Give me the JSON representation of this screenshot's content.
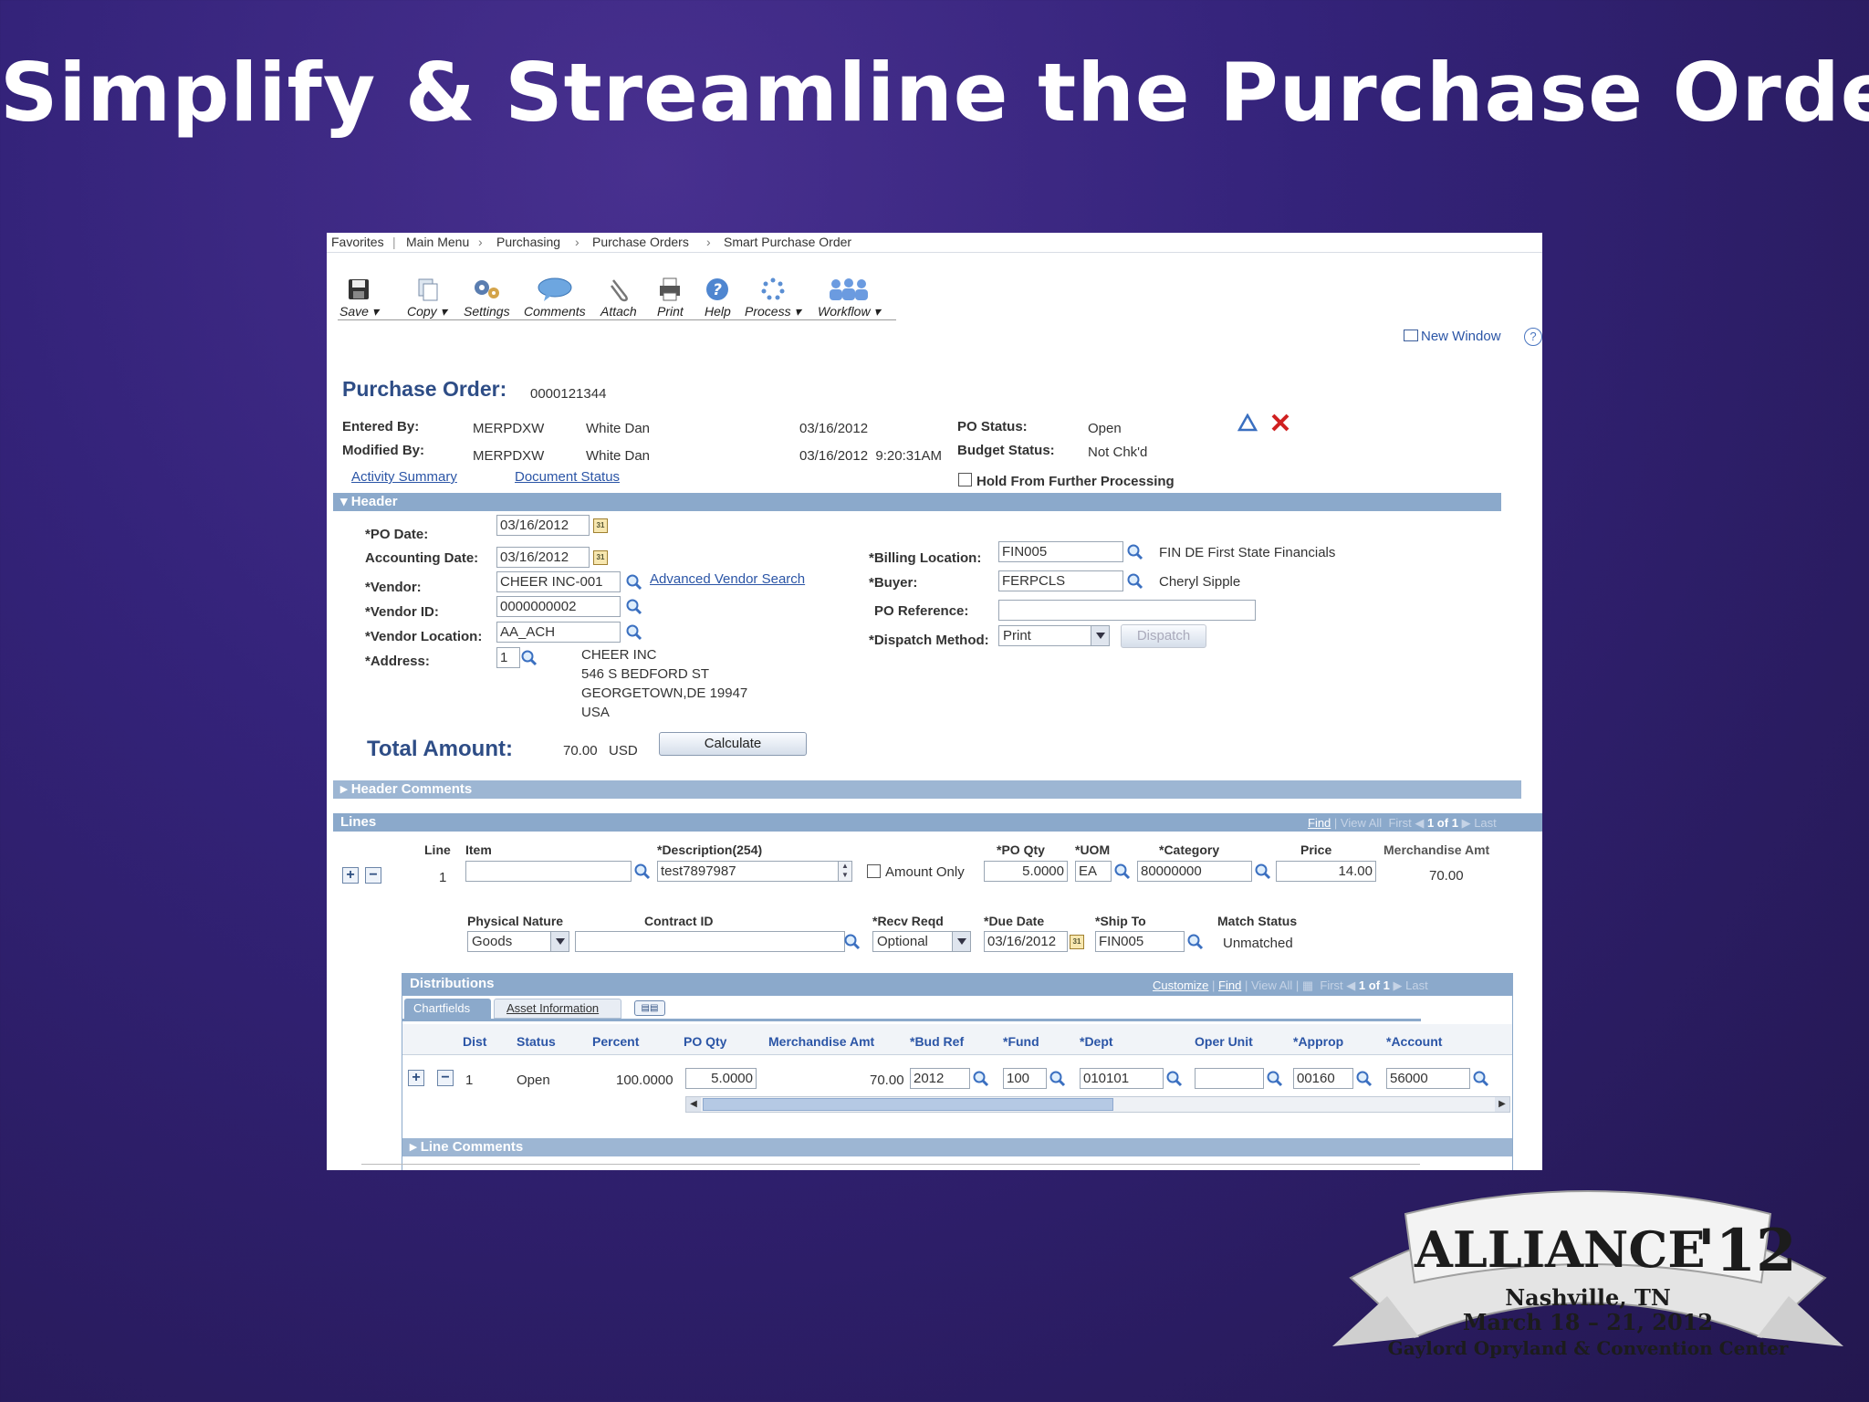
{
  "slide": {
    "title": "Simplify & Streamline the Purchase Order"
  },
  "breadcrumb": [
    "Favorites",
    "Main Menu",
    "Purchasing",
    "Purchase Orders",
    "Smart Purchase Order"
  ],
  "toolbar": [
    "Save",
    "Copy",
    "Settings",
    "Comments",
    "Attach",
    "Print",
    "Help",
    "Process",
    "Workflow"
  ],
  "new_window": "New Window",
  "po": {
    "title": "Purchase Order:",
    "number": "0000121344",
    "entered_by_label": "Entered By:",
    "entered_by_id": "MERPDXW",
    "entered_by_name": "White Dan",
    "entered_date": "03/16/2012",
    "modified_by_label": "Modified By:",
    "modified_by_id": "MERPDXW",
    "modified_by_name": "White Dan",
    "modified_date": "03/16/2012  9:20:31AM",
    "po_status_label": "PO Status:",
    "po_status": "Open",
    "budget_status_label": "Budget Status:",
    "budget_status": "Not Chk'd",
    "activity_summary": "Activity Summary",
    "document_status": "Document Status",
    "hold": "Hold From Further Processing"
  },
  "header": {
    "section": "Header",
    "po_date_label": "*PO Date:",
    "po_date": "03/16/2012",
    "accounting_date_label": "Accounting Date:",
    "accounting_date": "03/16/2012",
    "vendor_label": "*Vendor:",
    "vendor": "CHEER INC-001",
    "advanced_vendor_search": "Advanced Vendor Search",
    "vendor_id_label": "*Vendor ID:",
    "vendor_id": "0000000002",
    "vendor_location_label": "*Vendor Location:",
    "vendor_location": "AA_ACH",
    "address_label": "*Address:",
    "address_seq": "1",
    "address_lines": [
      "CHEER INC",
      "546 S BEDFORD ST",
      "GEORGETOWN,DE 19947",
      "USA"
    ],
    "billing_location_label": "*Billing Location:",
    "billing_location": "FIN005",
    "billing_location_desc": "FIN DE First State Financials",
    "buyer_label": "*Buyer:",
    "buyer": "FERPCLS",
    "buyer_name": "Cheryl Sipple",
    "po_reference_label": "PO Reference:",
    "po_reference": "",
    "dispatch_method_label": "*Dispatch Method:",
    "dispatch_method": "Print",
    "dispatch_button": "Dispatch",
    "total_label": "Total Amount:",
    "total_amount": "70.00",
    "currency": "USD",
    "calculate": "Calculate",
    "header_comments": "Header Comments"
  },
  "lines": {
    "section": "Lines",
    "nav": {
      "find": "Find",
      "view_all": "View All",
      "first": "First",
      "count": "1 of 1",
      "last": "Last"
    },
    "headers": {
      "line": "Line",
      "item": "Item",
      "description": "*Description(254)",
      "po_qty": "*PO Qty",
      "uom": "*UOM",
      "category": "*Category",
      "price": "Price",
      "merch_amt": "Merchandise Amt"
    },
    "row": {
      "line": "1",
      "item": "",
      "description": "test7897987",
      "amount_only": "Amount Only",
      "po_qty": "5.0000",
      "uom": "EA",
      "category": "80000000",
      "price": "14.00",
      "merch_amt": "70.00"
    },
    "headers2": {
      "physical_nature": "Physical Nature",
      "contract_id": "Contract ID",
      "recv_reqd": "*Recv Reqd",
      "due_date": "*Due Date",
      "ship_to": "*Ship To",
      "match_status": "Match Status"
    },
    "row2": {
      "physical_nature": "Goods",
      "contract_id": "",
      "recv_reqd": "Optional",
      "due_date": "03/16/2012",
      "ship_to": "FIN005",
      "match_status": "Unmatched"
    },
    "line_comments": "Line Comments"
  },
  "distributions": {
    "section": "Distributions",
    "nav": {
      "customize": "Customize",
      "find": "Find",
      "view_all": "View All",
      "first": "First",
      "count": "1 of 1",
      "last": "Last"
    },
    "tabs": [
      "Chartfields",
      "Asset Information"
    ],
    "columns": [
      "Dist",
      "Status",
      "Percent",
      "PO Qty",
      "Merchandise Amt",
      "*Bud Ref",
      "*Fund",
      "*Dept",
      "Oper Unit",
      "*Approp",
      "*Account"
    ],
    "row": {
      "dist": "1",
      "status": "Open",
      "percent": "100.0000",
      "po_qty": "5.0000",
      "merch_amt": "70.00",
      "bud_ref": "2012",
      "fund": "100",
      "dept": "010101",
      "oper_unit": "",
      "approp": "00160",
      "account": "56000"
    }
  },
  "logo": {
    "name": "ALLIANCE",
    "year": "'12",
    "city": "Nashville, TN",
    "dates": "March 18 – 21, 2012",
    "venue": "Gaylord Opryland & Convention Center"
  },
  "colors": {
    "bar": "#8ba9cb",
    "link": "#2b55a6",
    "title_text": "#2e4d86",
    "background": "#2b1d66"
  }
}
